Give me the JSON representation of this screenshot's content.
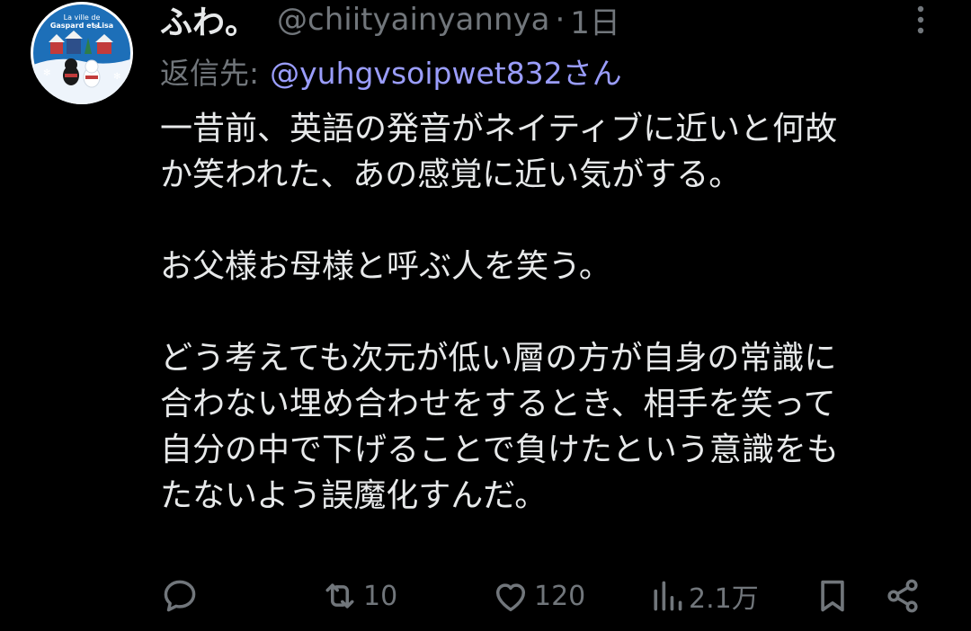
{
  "tweet": {
    "display_name": "ふわ。",
    "handle": "@chiityainyannya",
    "separator": "·",
    "time": "1日",
    "reply_label": "返信先:",
    "reply_handle": "@yuhgvsoipwet832さん",
    "lines": [
      "一昔前、英語の発音がネイティブに近いと何故",
      "か笑われた、あの感覚に近い気がする。",
      "",
      "お父様お母様と呼ぶ人を笑う。",
      "",
      "どう考えても次元が低い層の方が自身の常識に",
      "合わない埋め合わせをするとき、相手を笑って",
      "自分の中で下げることで負けたという意識をも",
      "たないよう誤魔化すんだ。"
    ]
  },
  "avatar": {
    "text_line1": "La ville de",
    "text_line2": "Gaspard et Lisa",
    "icon": "avatar-illustration"
  },
  "actions": {
    "reply_icon": "reply-icon",
    "reply_count": "",
    "repost_icon": "repost-icon",
    "repost_count": "10",
    "like_icon": "heart-icon",
    "like_count": "120",
    "views_icon": "views-icon",
    "views_count": "2.1万",
    "bookmark_icon": "bookmark-icon",
    "share_icon": "share-icon"
  },
  "colors": {
    "background": "#000000",
    "text_primary": "#e7e9ea",
    "text_secondary": "#71767b",
    "mention": "#9a9dfc",
    "avatar_bg": "#1d6fb8"
  }
}
